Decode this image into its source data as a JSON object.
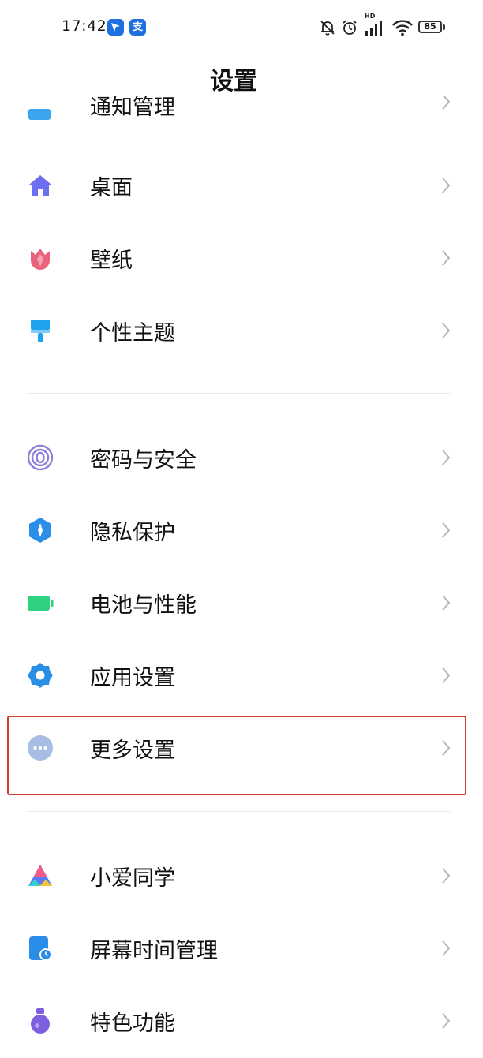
{
  "status_bar": {
    "time": "17:42",
    "app_icons": [
      "navigation-app-icon",
      "alipay-icon"
    ],
    "app_icon_chars": [
      "",
      "支"
    ],
    "right_icons": [
      "mute-bell-icon",
      "alarm-icon",
      "signal-icon",
      "wifi-icon"
    ],
    "network_label": "HD",
    "battery_level": "85"
  },
  "header": {
    "title": "设置"
  },
  "list": {
    "partial_item": {
      "label": "通知管理",
      "icon": "notification-icon",
      "icon_color": "#3aa4ee"
    },
    "group1": [
      {
        "label": "桌面",
        "icon": "home-icon",
        "icon_color": "#6e6ff0"
      },
      {
        "label": "壁纸",
        "icon": "tulip-icon",
        "icon_color": "#e8637b"
      },
      {
        "label": "个性主题",
        "icon": "paintbrush-icon",
        "icon_color": "#1ea4ef"
      }
    ],
    "group2": [
      {
        "label": "密码与安全",
        "icon": "fingerprint-icon",
        "icon_color": "#8a7fd9"
      },
      {
        "label": "隐私保护",
        "icon": "privacy-shield-icon",
        "icon_color": "#2a8de8"
      },
      {
        "label": "电池与性能",
        "icon": "battery-icon",
        "icon_color": "#2dd17f"
      },
      {
        "label": "应用设置",
        "icon": "gear-icon",
        "icon_color": "#2b8ee6"
      },
      {
        "label": "更多设置",
        "icon": "more-dots-icon",
        "icon_color": "#a9bde4"
      }
    ],
    "group3": [
      {
        "label": "小爱同学",
        "icon": "xiaoai-icon",
        "icon_color": "#5a7cf0"
      },
      {
        "label": "屏幕时间管理",
        "icon": "screen-time-icon",
        "icon_color": "#2a8de8"
      },
      {
        "label": "特色功能",
        "icon": "flask-icon",
        "icon_color": "#7d5fe0"
      }
    ]
  },
  "highlight": {
    "target": "更多设置",
    "color": "#d43a2f"
  }
}
